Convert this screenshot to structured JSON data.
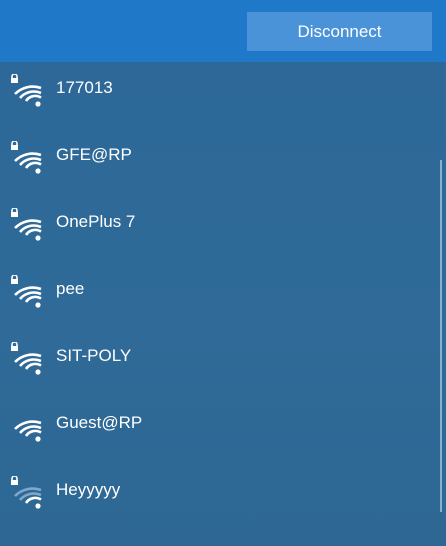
{
  "header": {
    "disconnect_label": "Disconnect"
  },
  "networks": [
    {
      "ssid": "177013",
      "secured": true,
      "signal_bars": 4,
      "icon": "wifi-secured-icon"
    },
    {
      "ssid": "GFE@RP",
      "secured": true,
      "signal_bars": 4,
      "icon": "wifi-secured-icon"
    },
    {
      "ssid": "OnePlus 7",
      "secured": true,
      "signal_bars": 4,
      "icon": "wifi-secured-icon"
    },
    {
      "ssid": "pee",
      "secured": true,
      "signal_bars": 4,
      "icon": "wifi-secured-icon"
    },
    {
      "ssid": "SIT-POLY",
      "secured": true,
      "signal_bars": 4,
      "icon": "wifi-secured-icon"
    },
    {
      "ssid": "Guest@RP",
      "secured": false,
      "signal_bars": 4,
      "icon": "wifi-icon"
    },
    {
      "ssid": "Heyyyyy",
      "secured": true,
      "signal_bars": 2,
      "icon": "wifi-secured-icon"
    }
  ],
  "colors": {
    "panel": "#2f6a98",
    "top_strip": "#1f78c8",
    "button": "#4a93d8",
    "text": "#ffffff",
    "weak_arc": "#7fa9cc"
  }
}
